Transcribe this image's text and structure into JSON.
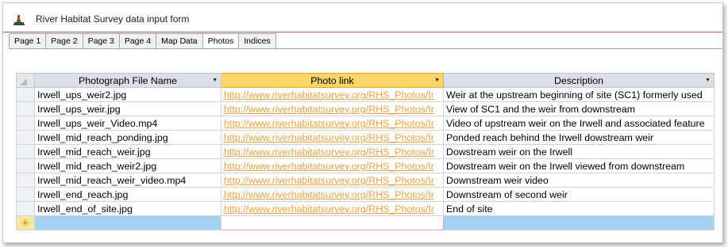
{
  "window": {
    "title": "River Habitat Survey data input form",
    "app_icon": "rhs-logo-icon"
  },
  "tabs": [
    {
      "label": "Page 1",
      "active": false
    },
    {
      "label": "Page 2",
      "active": false
    },
    {
      "label": "Page 3",
      "active": false
    },
    {
      "label": "Page 4",
      "active": false
    },
    {
      "label": "Map Data",
      "active": false
    },
    {
      "label": "Photos",
      "active": true
    },
    {
      "label": "Indices",
      "active": false
    }
  ],
  "grid": {
    "columns": [
      "Photograph File Name",
      "Photo link",
      "Description"
    ],
    "rows": [
      {
        "file": "Irwell_ups_weir2.jpg",
        "link": "http://www.riverhabitatsurvey.org/RHS_Photos/Ir",
        "desc": "Weir at the upstream beginning of site (SC1) formerly used"
      },
      {
        "file": "Irwell_ups_weir.jpg",
        "link": "http://www.riverhabitatsurvey.org/RHS_Photos/Ir",
        "desc": "View of SC1 and the weir from downstream"
      },
      {
        "file": "Irwell_ups_weir_Video.mp4",
        "link": "http://www.riverhabitatsurvey.org/RHS_Photos/Ir",
        "desc": "Video of upstream weir on the Irwell and associated feature"
      },
      {
        "file": "Irwell_mid_reach_ponding.jpg",
        "link": "http://www.riverhabitatsurvey.org/RHS_Photos/Ir",
        "desc": "Ponded reach behind the Irwell dowstream weir"
      },
      {
        "file": "Irwell_mid_reach_weir.jpg",
        "link": "http://www.riverhabitatsurvey.org/RHS_Photos/Ir",
        "desc": "Dowstream weir on the Irwell"
      },
      {
        "file": "Irwell_mid_reach_weir2.jpg",
        "link": "http://www.riverhabitatsurvey.org/RHS_Photos/Ir",
        "desc": "Dowstream weir on the Irwell viewed from downstream"
      },
      {
        "file": "Irwell_mid_reach_weir_video.mp4",
        "link": "http://www.riverhabitatsurvey.org/RHS_Photos/Ir",
        "desc": "Downstream weir video"
      },
      {
        "file": "Irwell_end_reach.jpg",
        "link": "http://www.riverhabitatsurvey.org/RHS_Photos/Ir",
        "desc": "Downstream of second weir"
      },
      {
        "file": "Irwell_end_of_site.jpg",
        "link": "http://www.riverhabitatsurvey.org/RHS_Photos/Ir",
        "desc": "End of site"
      }
    ],
    "new_record_marker": "✳"
  },
  "colors": {
    "accent_line": "#c0504d",
    "header_highlight": "#fcd56a",
    "link": "#e8a24a",
    "new_row": "#a8d0f0"
  }
}
